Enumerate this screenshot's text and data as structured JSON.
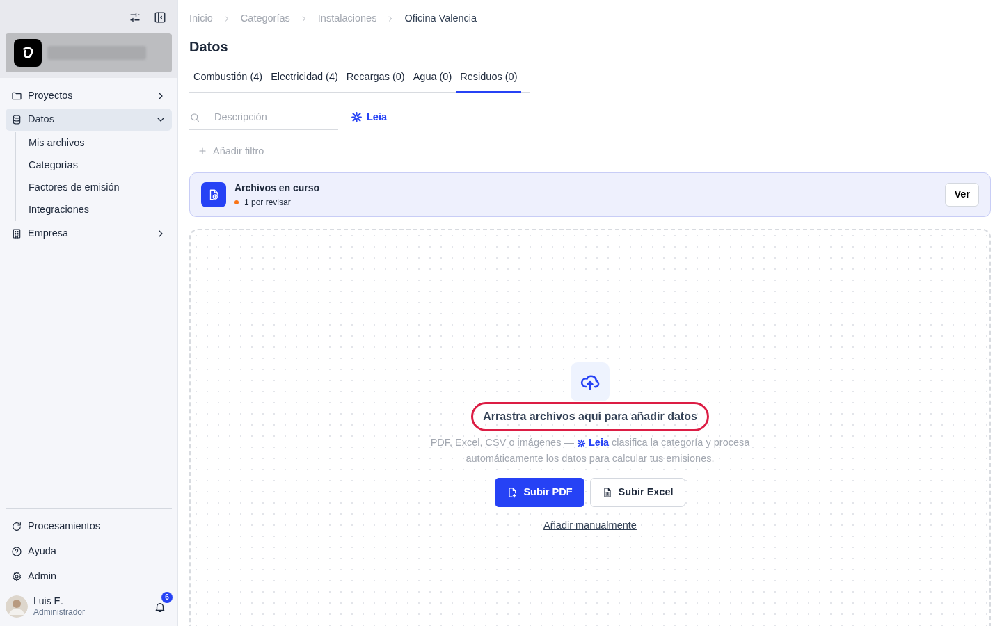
{
  "sidebar": {
    "nav": [
      {
        "label": "Proyectos",
        "selected": false,
        "expanded": false
      },
      {
        "label": "Datos",
        "selected": true,
        "expanded": true,
        "children": [
          {
            "label": "Mis archivos"
          },
          {
            "label": "Categorías"
          },
          {
            "label": "Factores de emisión"
          },
          {
            "label": "Integraciones"
          }
        ]
      },
      {
        "label": "Empresa",
        "selected": false,
        "expanded": false
      }
    ],
    "footer_items": [
      {
        "label": "Procesamientos"
      },
      {
        "label": "Ayuda"
      },
      {
        "label": "Admin"
      }
    ],
    "user": {
      "name": "Luis E.",
      "role": "Administrador",
      "notifications": "6"
    }
  },
  "breadcrumbs": [
    {
      "label": "Inicio",
      "current": false
    },
    {
      "label": "Categorías",
      "current": false
    },
    {
      "label": "Instalaciones",
      "current": false
    },
    {
      "label": "Oficina Valencia",
      "current": true
    }
  ],
  "title": "Datos",
  "tabs": [
    {
      "label": "Combustión (4)",
      "selected": false
    },
    {
      "label": "Electricidad (4)",
      "selected": false
    },
    {
      "label": "Recargas (0)",
      "selected": false
    },
    {
      "label": "Agua (0)",
      "selected": false
    },
    {
      "label": "Residuos (0)",
      "selected": true
    }
  ],
  "search": {
    "placeholder": "Descripción"
  },
  "assistant": {
    "label": "Leia"
  },
  "add_filter": "Añadir filtro",
  "banner": {
    "title": "Archivos en curso",
    "status": {
      "text": "1 por revisar",
      "color": "#f97316"
    },
    "button": "Ver"
  },
  "dropzone": {
    "title": "Arrastra archivos aquí para añadir datos",
    "highlighted": true,
    "description_before": "PDF, Excel, CSV o imágenes — ",
    "description_brand": "Leia",
    "description_after": " clasifica la categoría y procesa automáticamente los datos para calcular tus emisiones.",
    "buttons": [
      {
        "label": "Subir PDF",
        "kind": "primary"
      },
      {
        "label": "Subir Excel",
        "kind": "secondary"
      }
    ],
    "link": "Añadir manualmente"
  }
}
